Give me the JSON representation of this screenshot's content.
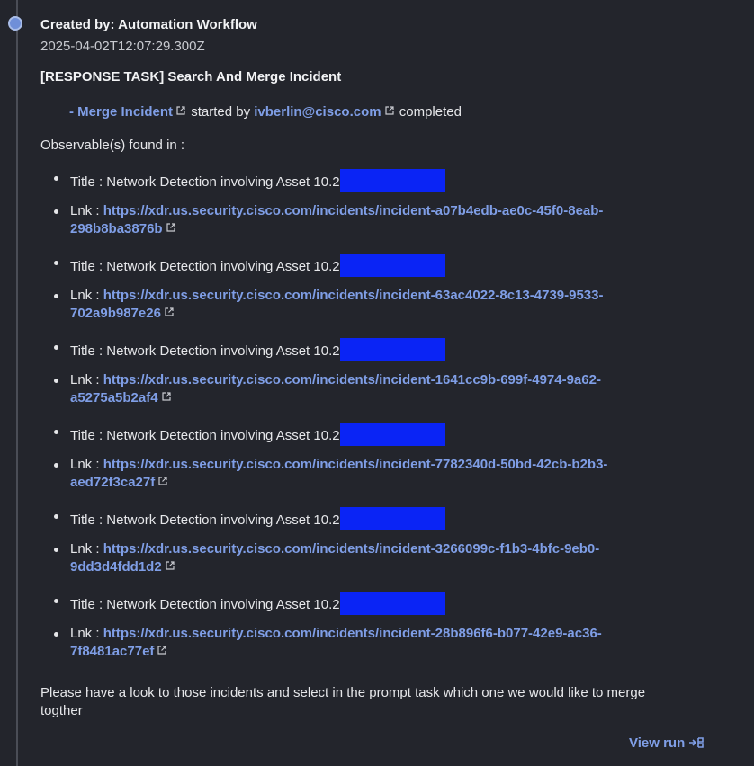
{
  "header": {
    "created_by": "Created by: Automation Workflow",
    "timestamp": "2025-04-02T12:07:29.300Z"
  },
  "task": {
    "title": "[RESPONSE TASK] Search And Merge Incident"
  },
  "merge_line": {
    "prefix": "- ",
    "workflow_link": "Merge Incident",
    "started_by_text": " started by ",
    "user_link": "ivberlin@cisco.com",
    "completed_text": " completed"
  },
  "observables_heading": "Observable(s) found in :",
  "incidents": [
    {
      "title_label": "Title : Network Detection involving Asset 10.2",
      "link_label": "Lnk : ",
      "url_line1": "https://xdr.us.security.cisco.com/incidents/incident-a07b4edb-ae0c-45f0-8eab-",
      "url_line2": "298b8ba3876b"
    },
    {
      "title_label": "Title : Network Detection involving Asset 10.2",
      "link_label": "Lnk : ",
      "url_line1": "https://xdr.us.security.cisco.com/incidents/incident-63ac4022-8c13-4739-9533-",
      "url_line2": "702a9b987e26"
    },
    {
      "title_label": "Title : Network Detection involving Asset 10.2",
      "link_label": "Lnk : ",
      "url_line1": "https://xdr.us.security.cisco.com/incidents/incident-1641cc9b-699f-4974-9a62-",
      "url_line2": "a5275a5b2af4"
    },
    {
      "title_label": "Title : Network Detection involving Asset 10.2",
      "link_label": "Lnk : ",
      "url_line1": "https://xdr.us.security.cisco.com/incidents/incident-7782340d-50bd-42cb-b2b3-",
      "url_line2": "aed72f3ca27f"
    },
    {
      "title_label": "Title : Network Detection involving Asset 10.2",
      "link_label": "Lnk : ",
      "url_line1": "https://xdr.us.security.cisco.com/incidents/incident-3266099c-f1b3-4bfc-9eb0-",
      "url_line2": "9dd3d4fdd1d2"
    },
    {
      "title_label": "Title : Network Detection involving Asset 10.2",
      "link_label": "Lnk : ",
      "url_line1": "https://xdr.us.security.cisco.com/incidents/incident-28b896f6-b077-42e9-ac36-",
      "url_line2": "7f8481ac77ef"
    }
  ],
  "footer": {
    "message": "Please have a look to those incidents and select in the prompt task which one we would like to merge togther",
    "view_run": "View run"
  },
  "icons": {
    "timeline_dot": "timeline-dot-icon",
    "external_link": "external-link-icon",
    "view_run": "run-arrow-icon",
    "redaction": "redaction-block"
  },
  "colors": {
    "background": "#23252c",
    "link": "#7f9ee6",
    "redaction": "#0a24f5",
    "timeline_dot": "#6f8fd8"
  }
}
